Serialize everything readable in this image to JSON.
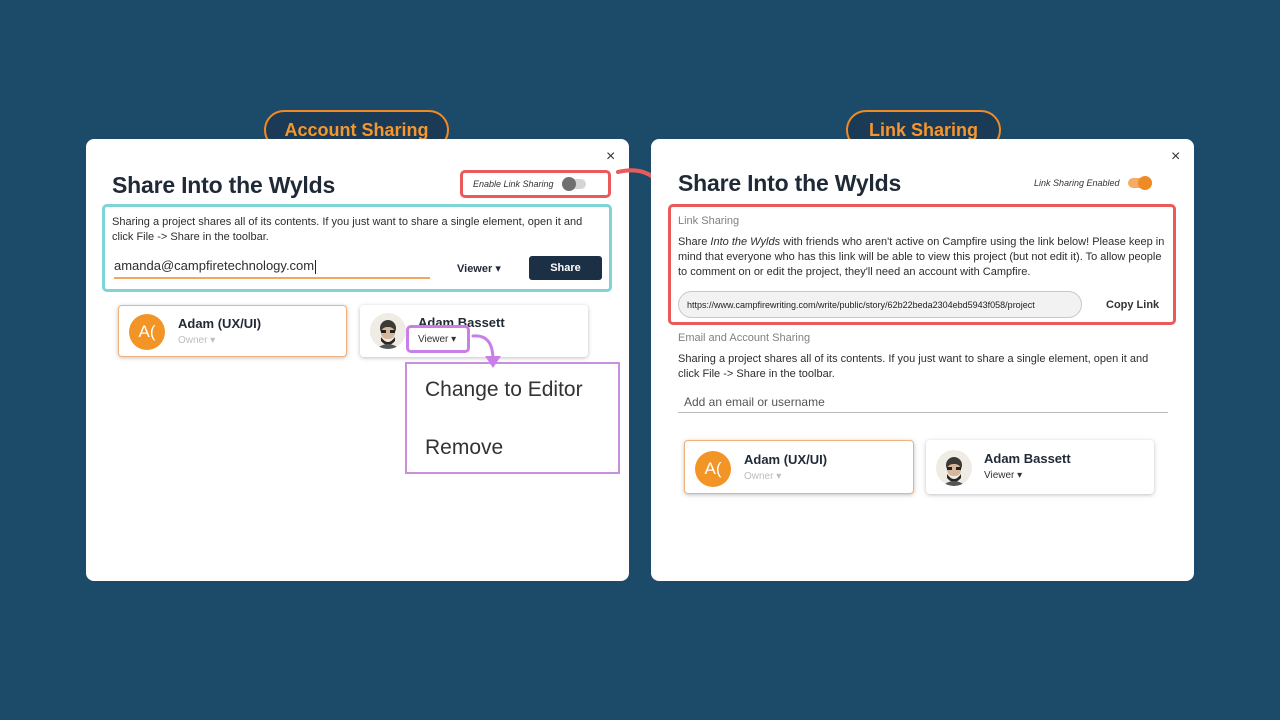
{
  "labels": {
    "left": "Account Sharing",
    "right": "Link Sharing"
  },
  "left_dialog": {
    "title": "Share Into the Wylds",
    "close": "×",
    "link_toggle_label": "Enable Link Sharing",
    "description": "Sharing a project shares all of its contents. If you just want to share a single element, open it and click File -> Share in the toolbar.",
    "email_value": "amanda@campfiretechnology.com",
    "role_select": "Viewer ▾",
    "share_button": "Share",
    "members": [
      {
        "initials": "A(",
        "name": "Adam (UX/UI)",
        "role": "Owner ▾"
      },
      {
        "name": "Adam Bassett",
        "role": "Viewer ▾"
      }
    ],
    "dropdown_menu": [
      "Change to Editor",
      "Remove"
    ]
  },
  "right_dialog": {
    "title": "Share Into the Wylds",
    "close": "×",
    "link_toggle_label": "Link Sharing Enabled",
    "link_sharing_label": "Link Sharing",
    "link_desc_1": "Share ",
    "link_desc_italic": "Into the Wylds",
    "link_desc_2": " with friends who aren't active on Campfire using the link below! Please keep in mind that everyone who has this link will be able to view this project (but not edit it). To allow people to comment on or edit the project, they'll need an account with Campfire.",
    "url": "https://www.campfirewriting.com/write/public/story/62b22beda2304ebd5943f058/project",
    "copy_link": "Copy Link",
    "email_section_label": "Email and Account Sharing",
    "email_desc": "Sharing a project shares all of its contents. If you just want to share a single element, open it and click File -> Share in the toolbar.",
    "add_placeholder": "Add an email or username",
    "members": [
      {
        "initials": "A(",
        "name": "Adam (UX/UI)",
        "role": "Owner ▾"
      },
      {
        "name": "Adam Bassett",
        "role": "Viewer ▾"
      }
    ]
  },
  "colors": {
    "background": "#1c4a69",
    "accent_orange": "#f08a24",
    "highlight_red": "#ea5a5a",
    "highlight_cyan": "#7fd4d6",
    "highlight_purple": "#c97ee8",
    "button_dark": "#1b2f45"
  },
  "icons": [
    "close-icon",
    "toggle-switch",
    "chevron-down-icon",
    "curved-arrow-icon"
  ]
}
